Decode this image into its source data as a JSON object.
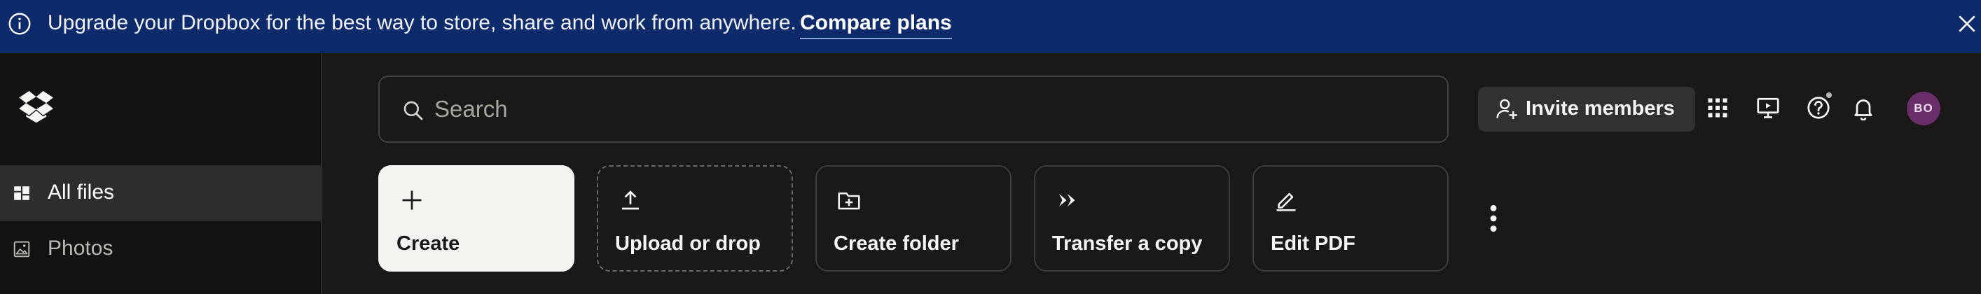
{
  "banner": {
    "message": "Upgrade your Dropbox for the best way to store, share and work from anywhere.",
    "cta": "Compare plans",
    "info_icon": "info-icon",
    "close_icon": "close-icon",
    "background": "#0d2a6b"
  },
  "sidebar": {
    "logo_icon": "dropbox-logo-icon",
    "items": [
      {
        "label": "All files",
        "icon": "all-files-icon",
        "active": true
      },
      {
        "label": "Photos",
        "icon": "photos-icon",
        "active": false
      }
    ]
  },
  "search": {
    "placeholder": "Search",
    "value": "",
    "icon": "search-icon"
  },
  "header": {
    "invite_label": "Invite members",
    "icons": [
      "invite-user-icon",
      "app-grid-icon",
      "present-icon",
      "help-icon",
      "notifications-bell-icon"
    ],
    "avatar_initials": "BO",
    "avatar_color": "#6a2e6b"
  },
  "actions": [
    {
      "label": "Create",
      "icon": "plus-icon"
    },
    {
      "label": "Upload or drop",
      "icon": "upload-icon"
    },
    {
      "label": "Create folder",
      "icon": "folder-plus-icon"
    },
    {
      "label": "Transfer a copy",
      "icon": "transfer-icon"
    },
    {
      "label": "Edit PDF",
      "icon": "edit-pdf-icon"
    }
  ],
  "more_icon": "more-vertical-icon",
  "colors": {
    "app_background": "#1a1918",
    "sidebar_background": "#141312",
    "active_item": "#2f2d2b",
    "primary_tile": "#f5f3f0"
  }
}
